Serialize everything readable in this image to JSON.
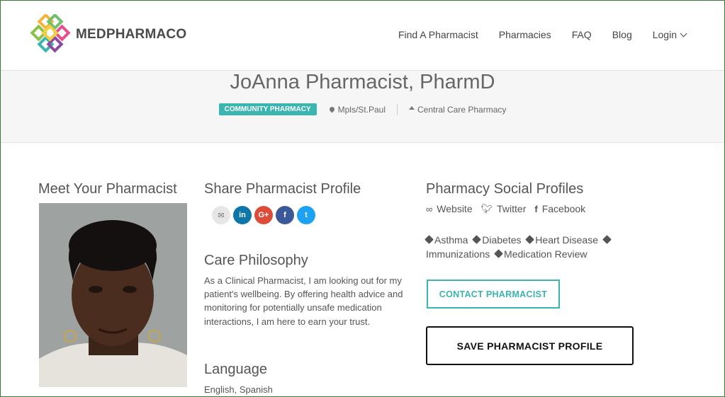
{
  "brand": {
    "name": "MEDPHARMACO"
  },
  "nav": {
    "items": [
      "Find A Pharmacist",
      "Pharmacies",
      "FAQ",
      "Blog"
    ],
    "login": "Login"
  },
  "profile": {
    "name": "JoAnna Pharmacist, PharmD",
    "badge": "COMMUNITY PHARMACY",
    "location": "Mpls/St.Paul",
    "pharmacy": "Central Care Pharmacy"
  },
  "meet": {
    "title": "Meet Your Pharmacist"
  },
  "share": {
    "title": "Share Pharmacist Profile",
    "icons": [
      "email-icon",
      "linkedin-icon",
      "google-plus-icon",
      "facebook-icon",
      "twitter-icon"
    ],
    "glyphs": [
      "✉",
      "in",
      "G+",
      "f",
      "t"
    ]
  },
  "care": {
    "title": "Care Philosophy",
    "text": "As a Clinical Pharmacist, I am looking out for my patient's wellbeing. By offering health advice and monitoring for potentially unsafe medication interactions, I am here to earn your trust."
  },
  "language": {
    "title": "Language",
    "value": "English, Spanish"
  },
  "social": {
    "title": "Pharmacy Social Profiles",
    "website": "Website",
    "twitter": "Twitter",
    "facebook": "Facebook"
  },
  "tags": [
    "Asthma",
    "Diabetes",
    "Heart Disease",
    "Immunizations",
    "Medication Review"
  ],
  "buttons": {
    "contact": "CONTACT PHARMACIST",
    "save": "SAVE PHARMACIST PROFILE"
  },
  "colors": {
    "accent": "#3ab5b0",
    "linkedin": "#0e76a8",
    "google": "#dd4b39",
    "facebook": "#3b5998",
    "twitter": "#1da1f2",
    "email": "#e5e5e5"
  }
}
